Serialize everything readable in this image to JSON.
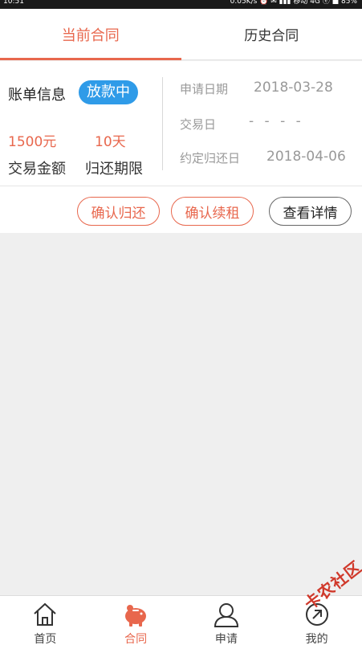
{
  "status_bar": {
    "time": "10:51",
    "right_text": "0.05K/s  ⏰  ✉  ▮▮▮  移动 4G  ⓔ  ■  85%"
  },
  "tabs": [
    {
      "label": "当前合同",
      "active": true
    },
    {
      "label": "历史合同",
      "active": false
    }
  ],
  "contract": {
    "bill_label": "账单信息",
    "status_badge": "放款中",
    "amount_value": "1500元",
    "days_value": "10天",
    "amount_label": "交易金额",
    "days_label": "归还期限",
    "apply_date_label": "申请日期",
    "apply_date_value": "2018-03-28",
    "trade_date_label": "交易日",
    "trade_date_value": "- - - -",
    "due_date_label": "约定归还日",
    "due_date_value": "2018-04-06"
  },
  "actions": {
    "confirm_return": "确认归还",
    "confirm_renew": "确认续租",
    "view_details": "查看详情"
  },
  "bottom_nav": [
    {
      "label": "首页",
      "icon": "home-icon",
      "active": false
    },
    {
      "label": "合同",
      "icon": "piggy-bank-icon",
      "active": true
    },
    {
      "label": "申请",
      "icon": "user-icon",
      "active": false
    },
    {
      "label": "我的",
      "icon": "profile-icon",
      "active": false
    }
  ],
  "watermark": {
    "text": "卡农社区"
  },
  "colors": {
    "accent": "#e8674d",
    "badge": "#2f9be8",
    "background": "#efefef"
  }
}
